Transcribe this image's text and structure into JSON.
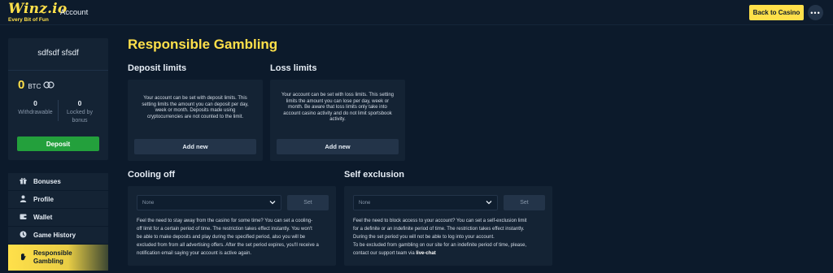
{
  "header": {
    "logo": "Winz.io",
    "tagline": "Every Bit of Fun",
    "nav_account": "Account",
    "back_button": "Back to Casino",
    "more_icon": "ellipsis-icon"
  },
  "profile": {
    "name": "sdfsdf sfsdf",
    "balance": "0",
    "currency": "BTC",
    "withdrawable_value": "0",
    "withdrawable_label": "Withdrawable",
    "locked_value": "0",
    "locked_label_1": "Locked by",
    "locked_label_2": "bonus",
    "deposit_button": "Deposit"
  },
  "menu": {
    "items": [
      {
        "label": "Bonuses",
        "icon": "gift-icon"
      },
      {
        "label": "Profile",
        "icon": "user-icon"
      },
      {
        "label": "Wallet",
        "icon": "wallet-icon"
      },
      {
        "label": "Game History",
        "icon": "history-icon"
      },
      {
        "label_1": "Responsible",
        "label_2": "Gambling",
        "icon": "hand-icon"
      }
    ]
  },
  "main": {
    "title": "Responsible Gambling",
    "deposit": {
      "title": "Deposit limits",
      "lines": [
        "Your account can be set with deposit limits. This",
        "setting limits the amount you can deposit per day,",
        "week or month. Deposits made using",
        "cryptocurrencies are not counted to the limit."
      ],
      "button": "Add new"
    },
    "loss": {
      "title": "Loss limits",
      "lines": [
        "Your account can be set with loss limits. This setting",
        "limits the amount you can lose per day, week or",
        "month. Be aware that loss limits only take into",
        "account casino activity and do not limit sportsbook",
        "activity."
      ],
      "button": "Add new"
    },
    "cooling": {
      "title": "Cooling off",
      "select_value": "None",
      "set_button": "Set",
      "lines": [
        "Feel the need to stay away from the casino for some time? You can set a cooling-",
        "off limit for a certain period of time. The restriction takes effect instantly. You won't",
        "be able to make deposits and play during the specified period, also you will be",
        "excluded from from all advertising offers. After the set period expires, you'll receive a",
        "notification email saying your account is active again."
      ]
    },
    "self_exclusion": {
      "title": "Self exclusion",
      "select_value": "None",
      "set_button": "Set",
      "lines": [
        "Feel the need to block access to your account? You can set a self-exclusion limit",
        "for a definite or an indefinite period of time. The restriction takes effect instantly.",
        "During the set period you will not be able to log into your account.",
        "To be excluded from gambling on our site for an indefinite period of time, please,"
      ],
      "last_line_prefix": "contact our support team via ",
      "last_line_link": "live-chat"
    }
  },
  "colors": {
    "accent": "#ffe04a",
    "background": "#0c1a2b",
    "card": "#142334",
    "deposit_green": "#23a03c"
  }
}
